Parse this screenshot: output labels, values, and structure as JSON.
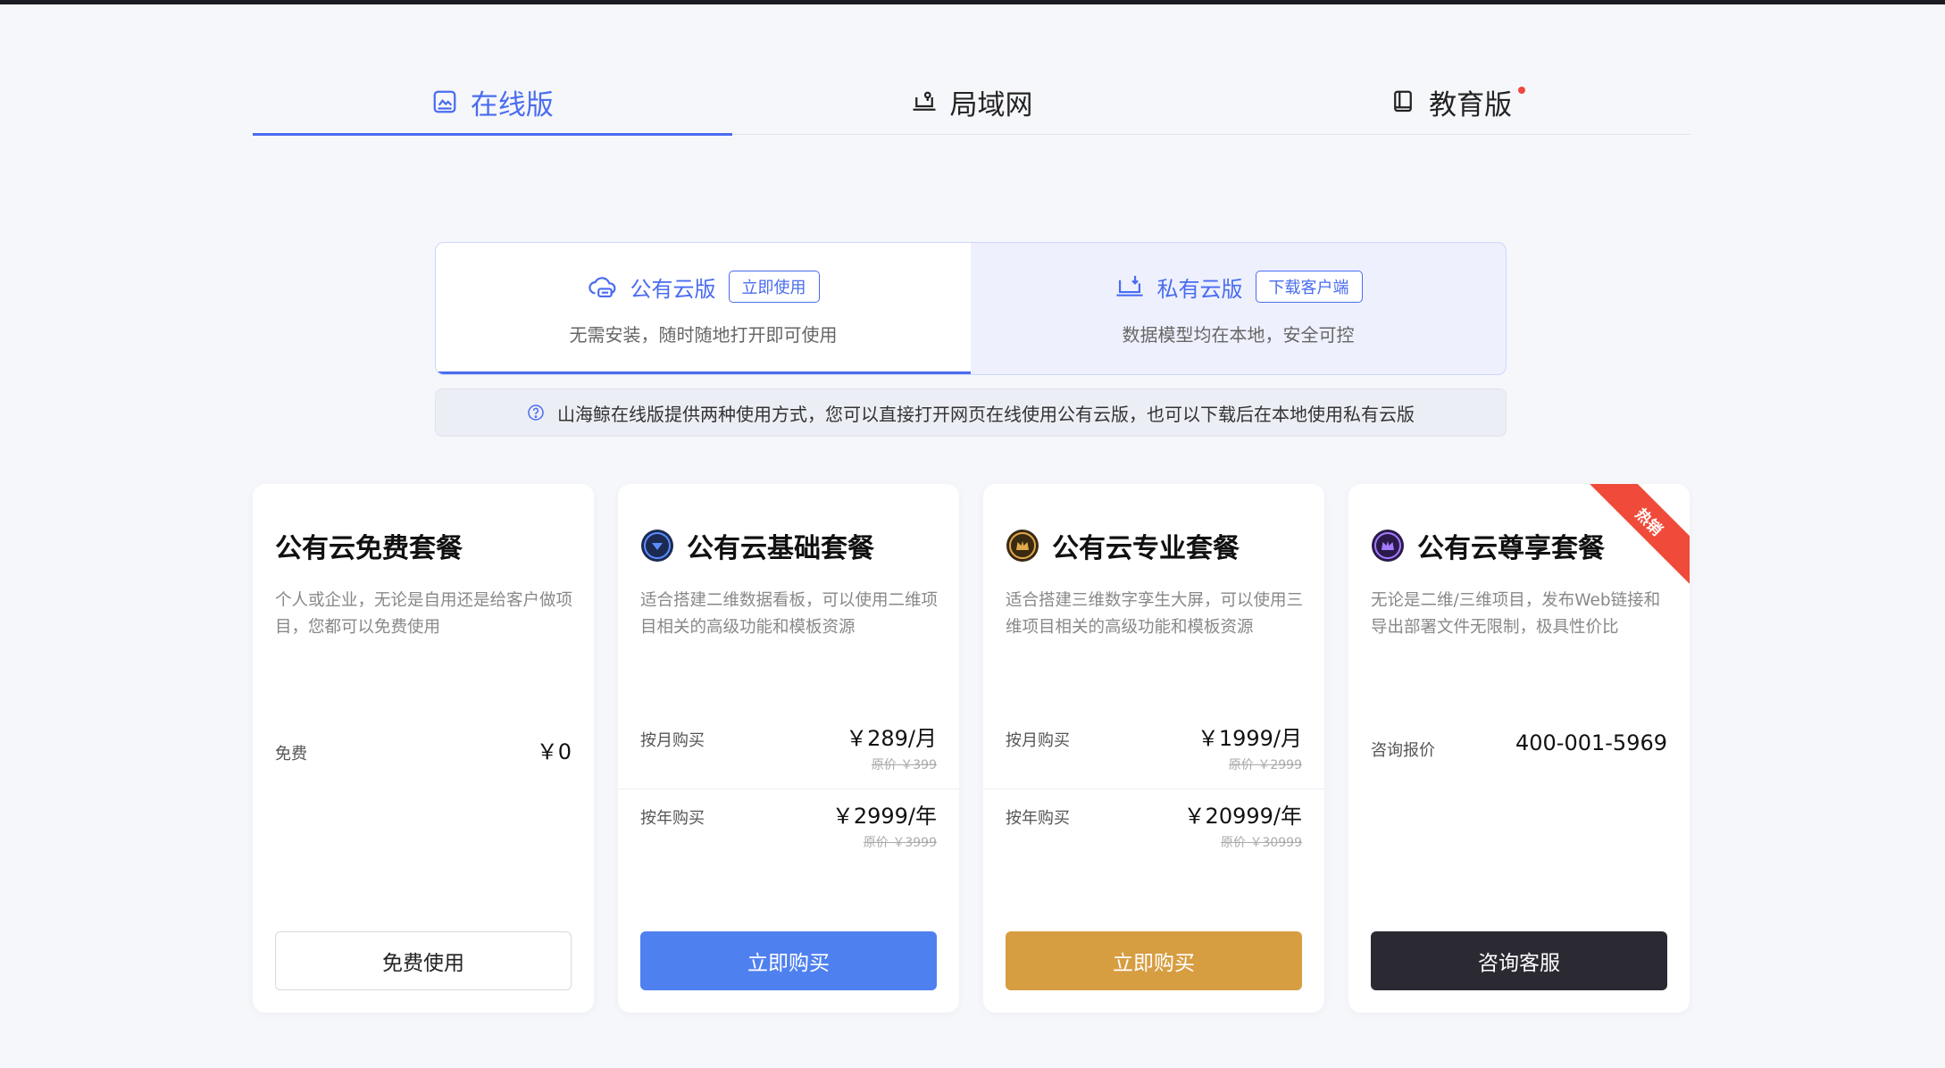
{
  "tabs": [
    {
      "label": "在线版",
      "icon": "monitor-icon",
      "active": true
    },
    {
      "label": "局域网",
      "icon": "lan-laptop-icon",
      "active": false
    },
    {
      "label": "教育版",
      "icon": "book-icon",
      "active": false,
      "has_dot": true
    }
  ],
  "deploy": {
    "public": {
      "title": "公有云版",
      "tag": "立即使用",
      "desc": "无需安装，随时随地打开即可使用"
    },
    "private": {
      "title": "私有云版",
      "tag": "下载客户端",
      "desc": "数据模型均在本地，安全可控"
    }
  },
  "notice": {
    "text": "山海鲸在线版提供两种使用方式，您可以直接打开网页在线使用公有云版，也可以下载后在本地使用私有云版"
  },
  "cards": [
    {
      "title": "公有云免费套餐",
      "desc": "个人或企业，无论是自用还是给客户做项目，您都可以免费使用",
      "row1": {
        "label": "免费",
        "price": "￥0"
      },
      "button": "免费使用"
    },
    {
      "title": "公有云基础套餐",
      "desc": "适合搭建二维数据看板，可以使用二维项目相关的高级功能和模板资源",
      "row1": {
        "label": "按月购买",
        "price": "￥289/月",
        "orig": "原价 ￥399"
      },
      "row2": {
        "label": "按年购买",
        "price": "￥2999/年",
        "orig": "原价 ￥3999"
      },
      "button": "立即购买"
    },
    {
      "title": "公有云专业套餐",
      "desc": "适合搭建三维数字孪生大屏，可以使用三维项目相关的高级功能和模板资源",
      "row1": {
        "label": "按月购买",
        "price": "￥1999/月",
        "orig": "原价 ￥2999"
      },
      "row2": {
        "label": "按年购买",
        "price": "￥20999/年",
        "orig": "原价 ￥30999"
      },
      "button": "立即购买"
    },
    {
      "title": "公有云尊享套餐",
      "desc": "无论是二维/三维项目，发布Web链接和导出部署文件无限制，极具性价比",
      "row1": {
        "label": "咨询报价",
        "price": "400-001-5969"
      },
      "button": "咨询客服",
      "ribbon": "热销"
    }
  ],
  "colors": {
    "accent": "#4a6cf0",
    "blue_button": "#4f80f0",
    "gold_button": "#d79d41",
    "dark_button": "#2b2a33",
    "hot_ribbon": "#f04b3a"
  }
}
